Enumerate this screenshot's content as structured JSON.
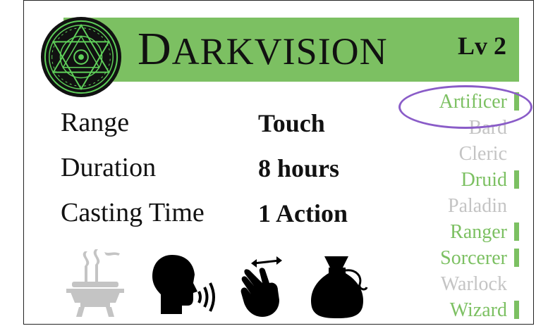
{
  "spell": {
    "name_first_letter": "D",
    "name_rest": "ARKVISION",
    "level": "Lv 2"
  },
  "stats": [
    {
      "label": "Range",
      "value": "Touch"
    },
    {
      "label": "Duration",
      "value": "8 hours"
    },
    {
      "label": "Casting Time",
      "value": "1 Action"
    }
  ],
  "classes": [
    {
      "name": "Artificer",
      "available": true,
      "highlighted": true
    },
    {
      "name": "Bard",
      "available": false
    },
    {
      "name": "Cleric",
      "available": false
    },
    {
      "name": "Druid",
      "available": true
    },
    {
      "name": "Paladin",
      "available": false
    },
    {
      "name": "Ranger",
      "available": true
    },
    {
      "name": "Sorcerer",
      "available": true
    },
    {
      "name": "Warlock",
      "available": false
    },
    {
      "name": "Wizard",
      "available": true
    }
  ],
  "components": [
    {
      "icon": "ritual-brazier-icon",
      "active": false
    },
    {
      "icon": "verbal-speaking-head-icon",
      "active": true
    },
    {
      "icon": "somatic-hand-icon",
      "active": true
    },
    {
      "icon": "material-pouch-icon",
      "active": true
    }
  ],
  "colors": {
    "accent": "#7cc062",
    "inactive": "#c4c4c4",
    "highlight": "#8a5cc8",
    "text": "#111111"
  }
}
